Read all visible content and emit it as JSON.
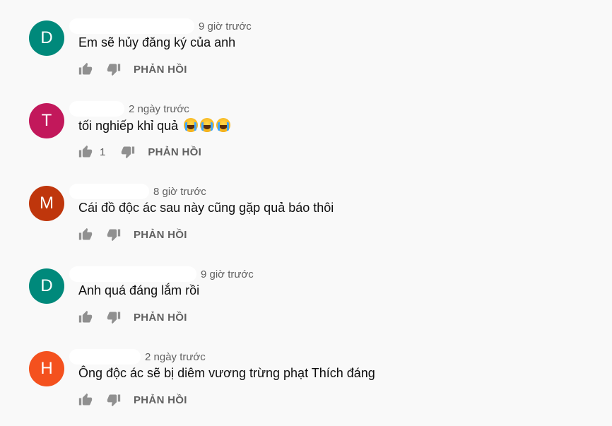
{
  "reply_label": "PHẢN HỒI",
  "comments": [
    {
      "initial": "D",
      "avatar_color": "#00897b",
      "time": "9 giờ trước",
      "text": "Em sẽ hủy đăng ký của anh",
      "emojis": 0,
      "like_count": ""
    },
    {
      "initial": "T",
      "avatar_color": "#c2185b",
      "time": "2 ngày trước",
      "text": "tối nghiếp khỉ quả",
      "emojis": 3,
      "emoji_name": "loudly-crying-face",
      "like_count": "1"
    },
    {
      "initial": "M",
      "avatar_color": "#bf360c",
      "time": "8 giờ trước",
      "text": "Cái đồ độc ác sau này cũng gặp quả báo thôi",
      "emojis": 0,
      "like_count": ""
    },
    {
      "initial": "D",
      "avatar_color": "#00897b",
      "time": "9 giờ trước",
      "text": "Anh quá đáng lắm rồi",
      "emojis": 0,
      "like_count": ""
    },
    {
      "initial": "H",
      "avatar_color": "#f4511e",
      "time": "2 ngày trước",
      "text": "Ông độc ác sẽ bị diêm vương trừng phạt Thích đáng",
      "emojis": 0,
      "like_count": ""
    }
  ],
  "icons": {
    "like": "thumb-up-icon",
    "dislike": "thumb-down-icon"
  }
}
